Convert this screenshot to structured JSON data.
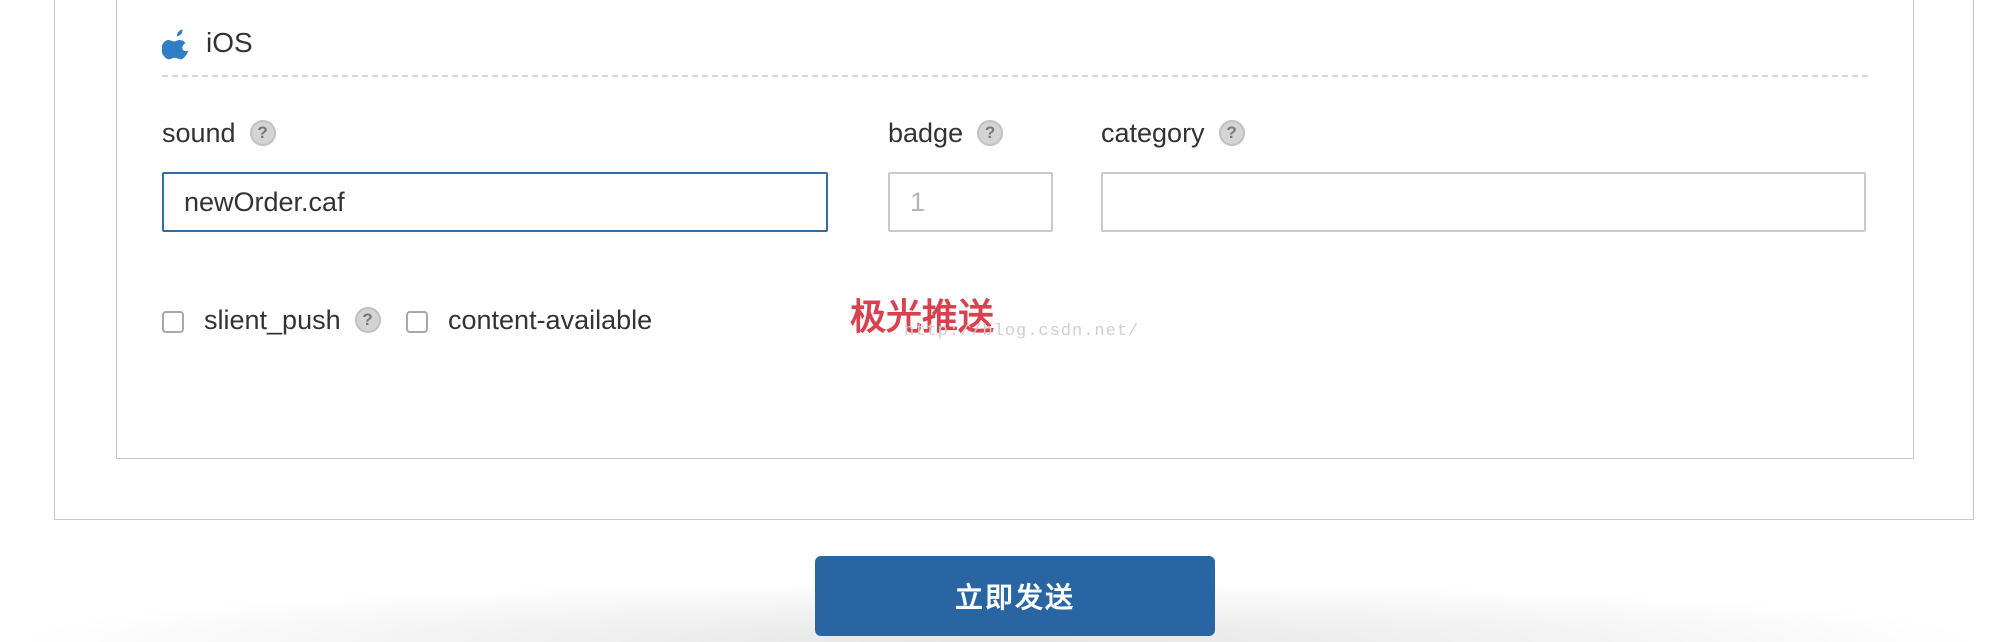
{
  "platform": {
    "icon": "apple-icon",
    "title": "iOS"
  },
  "fields": {
    "sound": {
      "label": "sound",
      "value": "newOrder.caf",
      "help": "?"
    },
    "badge": {
      "label": "badge",
      "placeholder": "1",
      "help": "?"
    },
    "category": {
      "label": "category",
      "value": "",
      "help": "?"
    }
  },
  "checkboxes": {
    "silent_push": {
      "label": "slient_push",
      "checked": false,
      "help": "?"
    },
    "content_available": {
      "label": "content-available",
      "checked": false
    }
  },
  "watermark": {
    "text": "极光推送",
    "url": "http://blog.csdn.net/"
  },
  "actions": {
    "send_label": "立即发送"
  },
  "colors": {
    "accent": "#2a65a3",
    "focus_border": "#2f6da7",
    "watermark": "#d8414d"
  }
}
